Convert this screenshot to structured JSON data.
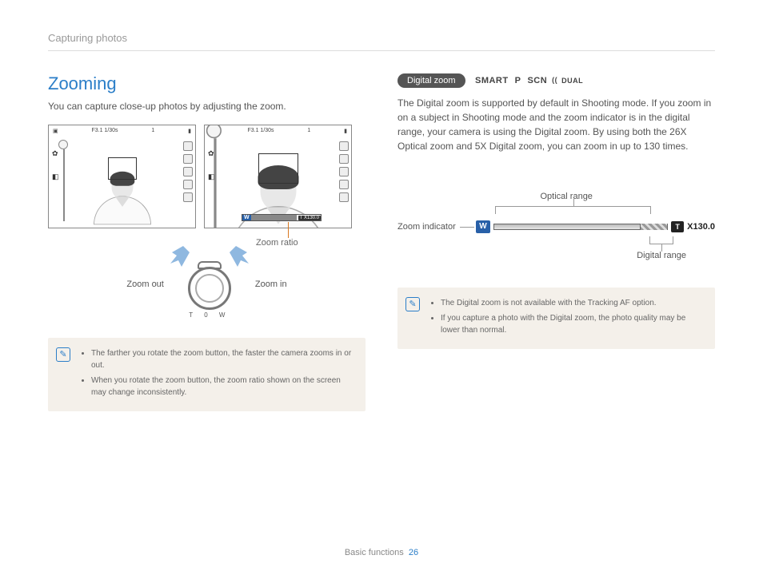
{
  "header": {
    "section": "Capturing photos"
  },
  "left": {
    "title": "Zooming",
    "intro": "You can capture close-up photos by adjusting the zoom.",
    "screen_overlay": {
      "exposure": "F3.1 1/30s",
      "mode": "1"
    },
    "zoom_bar_label": "T X130.0",
    "caption_zoom_ratio": "Zoom ratio",
    "dial": {
      "zoom_out": "Zoom out",
      "zoom_in": "Zoom in",
      "scale": "T   0   W"
    },
    "notes": [
      "The farther you rotate the zoom button, the faster the camera zooms in or out.",
      "When you rotate the zoom button, the zoom ratio shown on the screen may change inconsistently."
    ]
  },
  "right": {
    "badge": "Digital zoom",
    "modes": {
      "smart": "SMART",
      "p": "P",
      "scn": "SCN",
      "dual": "DUAL"
    },
    "body": "The Digital zoom is supported by default in Shooting mode. If you zoom in on a subject in Shooting mode and the zoom indicator is in the digital range, your camera is using the Digital zoom. By using both the 26X Optical zoom and 5X Digital zoom, you can zoom in up to 130 times.",
    "indicator": {
      "zoom_indicator": "Zoom indicator",
      "optical_range": "Optical range",
      "digital_range": "Digital range",
      "W": "W",
      "T": "T",
      "value": "X130.0"
    },
    "notes": [
      "The Digital zoom is not available with the Tracking AF option.",
      "If you capture a photo with the Digital zoom, the photo quality may be lower than normal."
    ]
  },
  "footer": {
    "section": "Basic functions",
    "page": "26"
  }
}
